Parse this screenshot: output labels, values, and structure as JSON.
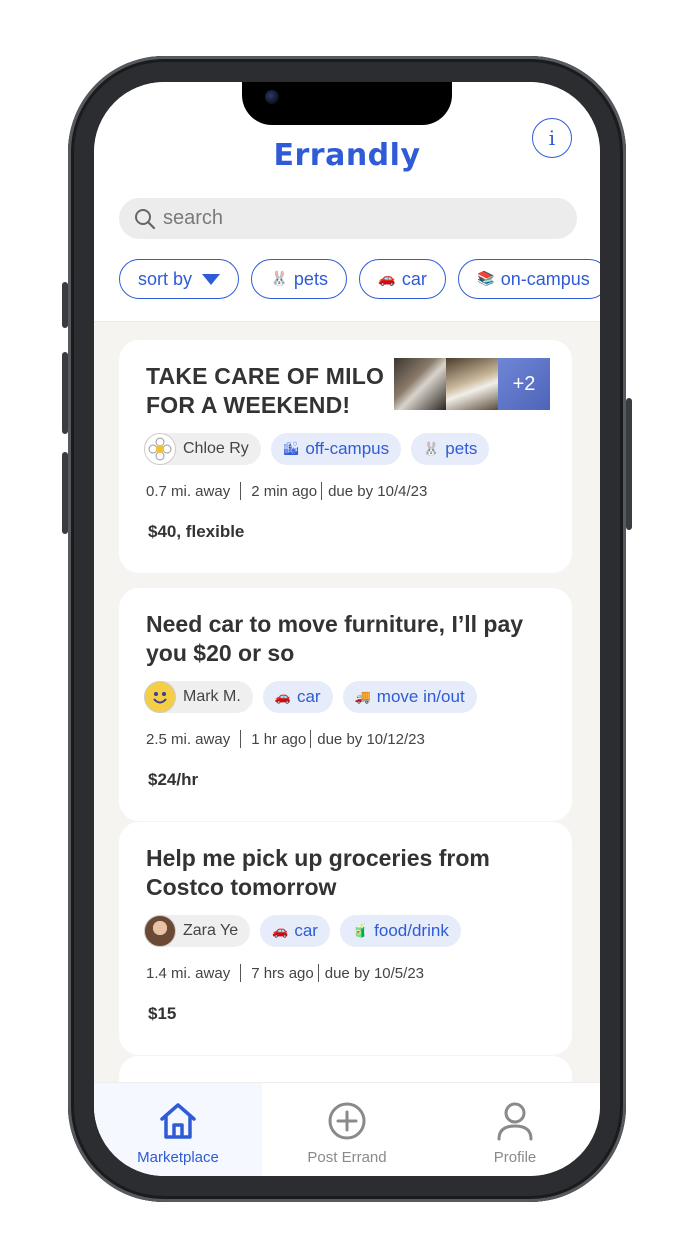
{
  "app": {
    "title": "Errandly",
    "info_label": "i"
  },
  "search": {
    "placeholder": "search"
  },
  "filters": [
    {
      "label": "sort by",
      "emoji": "",
      "has_caret": true
    },
    {
      "label": "pets",
      "emoji": "🐰"
    },
    {
      "label": "car",
      "emoji": "🚗"
    },
    {
      "label": "on-campus",
      "emoji": "📚"
    }
  ],
  "errands": [
    {
      "title": "TAKE CARE OF MILO FOR A WEEKEND!",
      "extra_photos": "+2",
      "user": "Chloe Ry",
      "tags": [
        {
          "emoji": "🏙",
          "label": "off-campus"
        },
        {
          "emoji": "🐰",
          "label": "pets"
        }
      ],
      "distance": "0.7 mi. away",
      "posted": "2 min ago",
      "due": "due by 10/4/23",
      "price": "$40, flexible"
    },
    {
      "title": "Need car to move furniture, I’ll pay you $20 or so",
      "user": "Mark M.",
      "tags": [
        {
          "emoji": "🚗",
          "label": "car"
        },
        {
          "emoji": "🚚",
          "label": "move in/out"
        }
      ],
      "distance": "2.5 mi. away",
      "posted": "1 hr ago",
      "due": "due by 10/12/23",
      "price": "$24/hr"
    },
    {
      "title": "Help me pick up groceries from Costco tomorrow",
      "user": "Zara Ye",
      "tags": [
        {
          "emoji": "🚗",
          "label": "car"
        },
        {
          "emoji": "🧃",
          "label": "food/drink"
        }
      ],
      "distance": "1.4 mi. away",
      "posted": "7 hrs ago",
      "due": "due by 10/5/23",
      "price": "$15"
    }
  ],
  "tabbar": {
    "active": "Marketplace",
    "items": [
      {
        "label": "Marketplace",
        "icon": "home-icon"
      },
      {
        "label": "Post Errand",
        "icon": "plus-circle-icon"
      },
      {
        "label": "Profile",
        "icon": "person-icon"
      }
    ]
  },
  "colors": {
    "accent": "#2f5bd6",
    "feed_bg": "#f5f4f1",
    "tag_bg": "#e7ecfb"
  }
}
